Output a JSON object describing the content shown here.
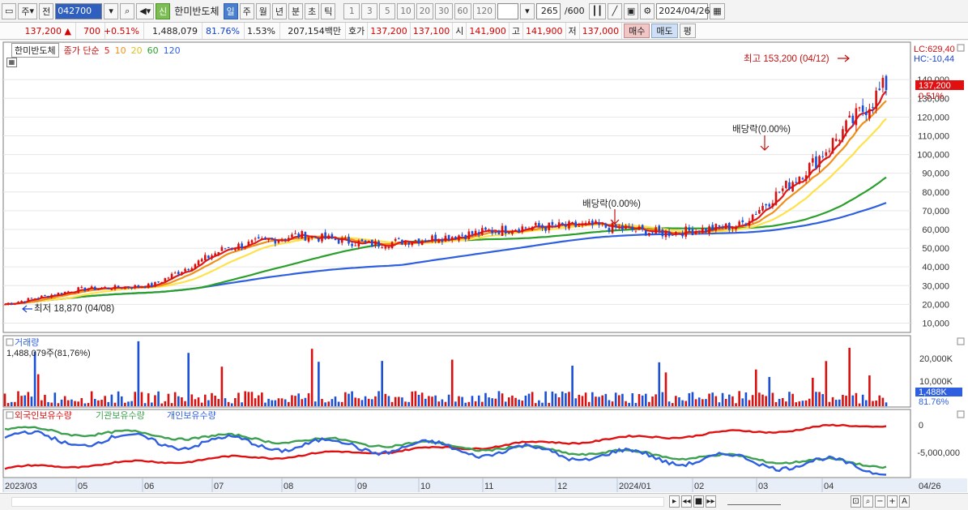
{
  "toolbar": {
    "market": "주",
    "prev": "전",
    "code": "042700",
    "tag": "신",
    "stock_name": "한미반도체",
    "periods": [
      "일",
      "주",
      "월",
      "년",
      "분",
      "초",
      "틱"
    ],
    "active_period": "일",
    "intervals": [
      "1",
      "3",
      "5",
      "10",
      "20",
      "30",
      "60",
      "120"
    ],
    "count": "265",
    "count_total": "/600",
    "date": "2024/04/26"
  },
  "quote": {
    "price": "137,200 ▲",
    "change": "700",
    "change_pct": "+0.51%",
    "volume": "1,488,079",
    "volume_ratio": "81.76%",
    "turnover": "1.53%",
    "amount": "207,154백만",
    "ask_label": "호가",
    "ask": "137,200",
    "bid": "137,100",
    "open_label": "시",
    "open": "141,900",
    "high_label": "고",
    "high": "141,900",
    "low_label": "저",
    "low": "137,000",
    "buy": "매수",
    "sell": "매도",
    "avg": "평"
  },
  "legend": {
    "name": "한미반도체",
    "type": "종가 단순",
    "mas": [
      "5",
      "10",
      "20",
      "60",
      "120"
    ]
  },
  "colors": {
    "up": "#d81010",
    "down": "#1a4fd6",
    "ma5": "#e01a1a",
    "ma10": "#f0901a",
    "ma20": "#ffe14a",
    "ma60": "#2aa02a",
    "ma120": "#2e5fe0",
    "foreign": "#e01010",
    "institution": "#3ca050",
    "individual": "#2e5fe0"
  },
  "right_labels": {
    "lc": "LC:629,40",
    "hc": "HC:-10,44",
    "last_price": "137,200",
    "last_pct": "0.51%",
    "volume_last": "1,488K",
    "volume_pct": "81.76%"
  },
  "annotations": {
    "high": "최고 153,200 (04/12)",
    "low": "최저 18,870 (04/08)",
    "dividend1": "배당락(0.00%)",
    "dividend2": "배당락(0.00%)"
  },
  "volume_panel": {
    "title": "거래량",
    "value": "1,488,079주(81,76%)",
    "ticks": [
      "20,000K",
      "10,000K"
    ]
  },
  "holdings_panel": {
    "foreign": "외국인보유수량",
    "institution": "기관보유수량",
    "individual": "개인보유수량",
    "ticks": [
      "0",
      "-5,000,000"
    ]
  },
  "x_labels": [
    "2023/03",
    "05",
    "06",
    "07",
    "08",
    "09",
    "10",
    "11",
    "12",
    "2024/01",
    "02",
    "03",
    "04"
  ],
  "x_last": "04/26",
  "chart_data": {
    "type": "candlestick",
    "title": "한미반도체",
    "price_axis": {
      "ticks": [
        10000,
        20000,
        30000,
        40000,
        50000,
        60000,
        70000,
        80000,
        90000,
        100000,
        110000,
        120000,
        130000,
        140000
      ],
      "range": [
        5000,
        160000
      ]
    },
    "months": [
      "2023/03",
      "05",
      "06",
      "07",
      "08",
      "09",
      "10",
      "11",
      "12",
      "2024/01",
      "02",
      "03",
      "04"
    ],
    "monthly_close": [
      20000,
      28000,
      30000,
      50000,
      57000,
      52000,
      56000,
      61000,
      62000,
      58000,
      62000,
      95000,
      137200
    ],
    "ma120_end": 81000,
    "ma60_end": 103000,
    "high": 153200,
    "low": 18870
  }
}
